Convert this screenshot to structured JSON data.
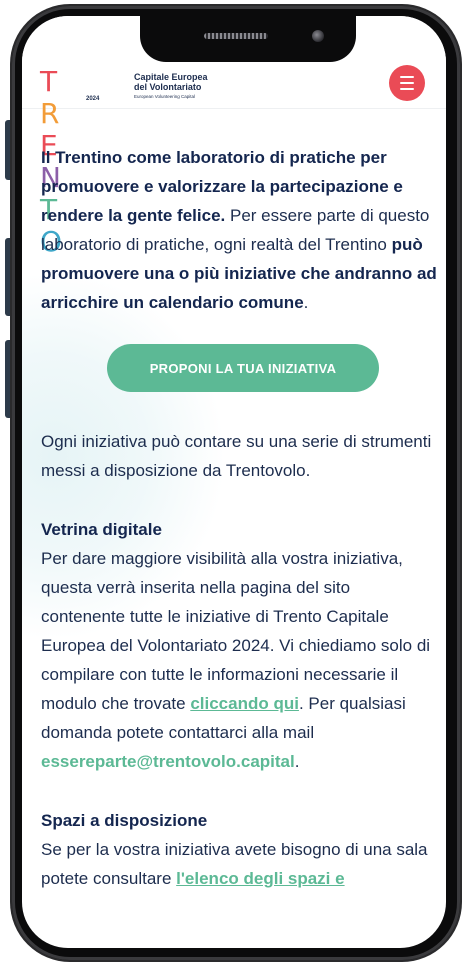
{
  "header": {
    "logo": {
      "letters": [
        {
          "char": "T",
          "color": "#ea4b56"
        },
        {
          "char": "R",
          "color": "#f29c38"
        },
        {
          "char": "E",
          "color": "#ea4b56"
        },
        {
          "char": "N",
          "color": "#8c5fa8"
        },
        {
          "char": "T",
          "color": "#5cb995"
        },
        {
          "char": "O",
          "color": "#3fa7c9"
        }
      ],
      "year": "2024",
      "line1": "Capitale Europea",
      "line2": "del Volontariato",
      "line3": "European Volunteering Capital"
    },
    "menu_icon": "hamburger-icon",
    "menu_color": "#ea4b56"
  },
  "content": {
    "intro_strong": "Il Trentino come laboratorio di pratiche per promuovere e valorizzare la partecipazione e rendere la gente felice.",
    "intro_text_1": "Per essere parte di questo laboratorio di pratiche, ogni realtà del Trentino ",
    "intro_text_strong": "può promuovere una o più iniziative che andranno ad arricchire un calendario comune",
    "intro_text_end": ".",
    "cta_label": "PROPONI LA TUA INIZIATIVA",
    "tools_text": "Ogni iniziativa può contare su una serie di strumenti messi a disposizione da Trentovolo.",
    "vetrina": {
      "title": "Vetrina digitale",
      "text_1": "Per dare maggiore visibilità alla vostra iniziativa, questa verrà inserita nella pagina del sito contenente tutte le iniziative di Trento Capitale Europea del Volontariato 2024. Vi chiediamo solo di compilare con tutte le informazioni necessarie il modulo che trovate ",
      "link": "cliccando qui",
      "text_2": ". Per qualsiasi domanda potete contattarci alla mail ",
      "email": "essereparte@trentovolo.capital",
      "text_3": "."
    },
    "spazi": {
      "title": "Spazi a disposizione",
      "text_1": "Se per la vostra iniziativa avete bisogno di una sala potete consultare ",
      "link": "l'elenco degli spazi e"
    }
  },
  "colors": {
    "navy": "#14264f",
    "green": "#5cb995",
    "red": "#ea4b56"
  }
}
